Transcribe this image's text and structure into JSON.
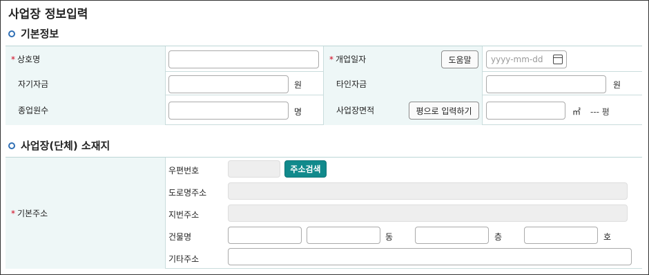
{
  "page": {
    "title": "사업장 정보입력"
  },
  "sections": {
    "basic": {
      "title": "기본정보"
    },
    "location": {
      "title": "사업장(단체) 소재지"
    }
  },
  "basic": {
    "business_name": {
      "label": "상호명",
      "required": "*",
      "value": ""
    },
    "open_date": {
      "label": "개업일자",
      "required": "*",
      "help_label": "도움말",
      "placeholder": "yyyy-mm-dd"
    },
    "own_funds": {
      "label": "자기자금",
      "unit": "원",
      "value": ""
    },
    "other_funds": {
      "label": "타인자금",
      "unit": "원",
      "value": ""
    },
    "employees": {
      "label": "종업원수",
      "unit": "명",
      "value": ""
    },
    "area": {
      "label": "사업장면적",
      "pyeong_button": "평으로 입력하기",
      "unit": "㎡",
      "pyeong_text": "--- 평"
    }
  },
  "address": {
    "label": "기본주소",
    "required": "*",
    "postal": {
      "label": "우편번호",
      "search_button": "주소검색"
    },
    "road": {
      "label": "도로명주소"
    },
    "lot": {
      "label": "지번주소"
    },
    "building": {
      "label": "건물명",
      "dong_unit": "동",
      "floor_unit": "층",
      "ho_unit": "호"
    },
    "other": {
      "label": "기타주소"
    }
  }
}
